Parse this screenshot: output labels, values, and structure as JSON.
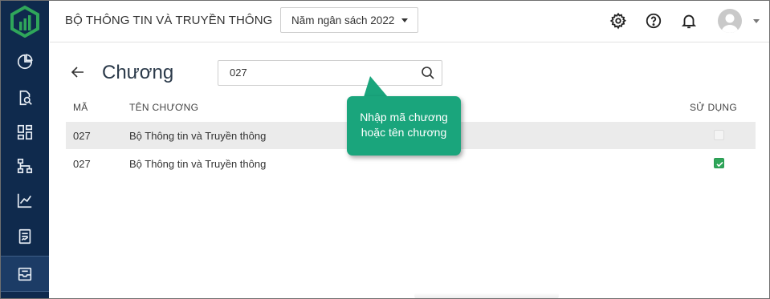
{
  "header": {
    "org_title": "BỘ THÔNG TIN VÀ TRUYỀN THÔNG",
    "budget_year": "Năm ngân sách 2022",
    "icons": [
      "gear-icon",
      "help-icon",
      "bell-icon",
      "avatar",
      "chevron-down-icon"
    ]
  },
  "sidebar": {
    "items": [
      {
        "icon": "pie-chart-icon"
      },
      {
        "icon": "document-search-icon"
      },
      {
        "icon": "dashboard-grid-icon"
      },
      {
        "icon": "hierarchy-icon"
      },
      {
        "icon": "line-chart-icon"
      },
      {
        "icon": "report-icon"
      },
      {
        "icon": "inbox-icon",
        "active": true
      }
    ]
  },
  "page": {
    "title": "Chương",
    "search_value": "027"
  },
  "table": {
    "headers": {
      "code": "MÃ",
      "name": "TÊN CHƯƠNG",
      "in_use": "SỬ DỤNG"
    },
    "rows": [
      {
        "code": "027",
        "name": "Bộ Thông tin và Truyền thông",
        "in_use": false
      },
      {
        "code": "027",
        "name": "Bộ Thông tin và Truyền thông",
        "in_use": true
      }
    ]
  },
  "tooltip": {
    "line1": "Nhập mã chương",
    "line2": "hoặc tên chương"
  },
  "colors": {
    "sidebar": "#0f2a4d",
    "logo": "#2fa65a",
    "tooltip": "#1aa57c",
    "checkbox_on": "#2fa65a",
    "row_shade": "#ebebeb"
  }
}
